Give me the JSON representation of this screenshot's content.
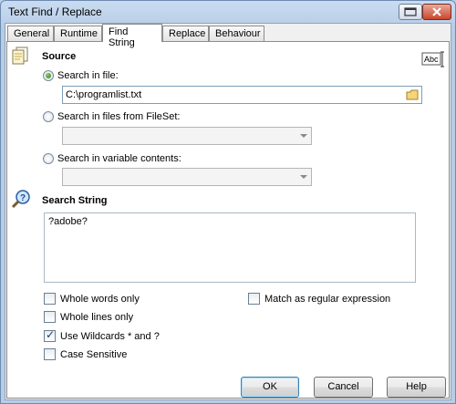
{
  "window": {
    "title": "Text Find / Replace"
  },
  "tabs": [
    {
      "label": "General"
    },
    {
      "label": "Runtime"
    },
    {
      "label": "Find String"
    },
    {
      "label": "Replace"
    },
    {
      "label": "Behaviour"
    }
  ],
  "source": {
    "heading": "Source",
    "radio_file": "Search in file:",
    "file_value": "C:\\programlist.txt",
    "radio_fileset": "Search in files from FileSet:",
    "radio_variable": "Search in variable contents:",
    "fileset_value": "",
    "variable_value": ""
  },
  "search": {
    "heading": "Search String",
    "value": "?adobe?"
  },
  "options": {
    "whole_words": "Whole words only",
    "whole_lines": "Whole lines only",
    "wildcards": "Use Wildcards * and ?",
    "case_sensitive": "Case Sensitive",
    "regex": "Match as regular expression"
  },
  "buttons": {
    "ok": "OK",
    "cancel": "Cancel",
    "help": "Help"
  },
  "icons": {
    "source": "documents-icon",
    "search": "magnifier-question-icon",
    "text_field": "abc-text-icon",
    "browse": "folder-icon"
  }
}
